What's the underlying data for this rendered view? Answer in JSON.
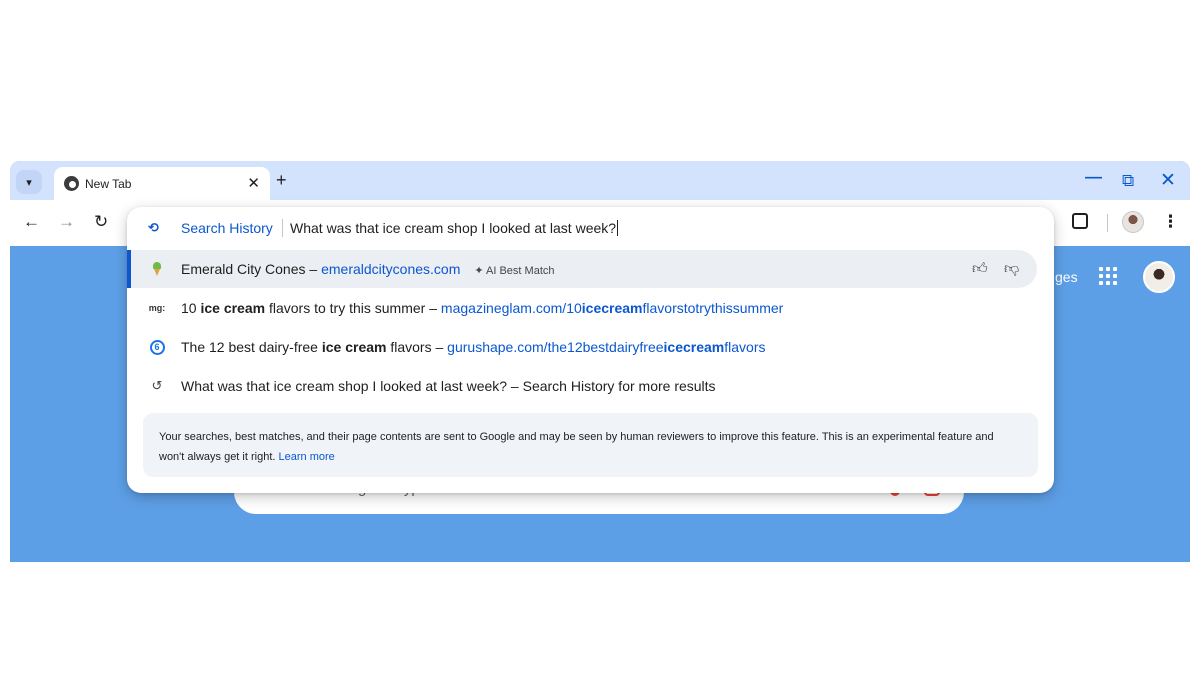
{
  "tab": {
    "title": "New Tab",
    "close_glyph": "✕",
    "new_tab_glyph": "+",
    "favicon": "chrome-icon"
  },
  "window_controls": {
    "minimize": "—",
    "restore": "⧉",
    "close": "✕"
  },
  "toolbar": {
    "back": "←",
    "forward": "→",
    "reload": "↻",
    "menu": "⋮"
  },
  "omnibox": {
    "scope_label": "Search History",
    "query": "What was that ice cream shop I looked at last week?",
    "suggestions": [
      {
        "icon": "ice-cream-cone-icon",
        "title": "Emerald City Cones",
        "separator": " – ",
        "url": "emeraldcitycones.com",
        "badge": "✦ AI Best Match",
        "selected": true
      },
      {
        "icon_text": "mg:",
        "title_pre": "10 ",
        "title_bold": "ice cream",
        "title_post": " flavors to try this summer",
        "separator": " – ",
        "url_pre": "magazineglam.com/10",
        "url_bold": "icecream",
        "url_post": "flavorstotrythissummer"
      },
      {
        "icon": "gurushape-icon",
        "title_pre": "The 12 best dairy-free ",
        "title_bold": "ice cream",
        "title_post": " flavors",
        "separator": " – ",
        "url_pre": "gurushape.com/the12bestdairyfree",
        "url_bold": "icecream",
        "url_post": "flavors"
      },
      {
        "icon": "history-icon",
        "text": "What was that ice cream shop I looked at last week? – Search History for more results"
      }
    ],
    "disclaimer": "Your searches, best matches, and their page contents are sent to Google and may be seen by human reviewers to improve this feature. This is an experimental feature and won't always get it right.",
    "learn_more": "Learn more"
  },
  "ntp": {
    "partial_link": "ges",
    "search_placeholder": "Search Google or type a URL"
  },
  "colors": {
    "accent": "#0b57d0",
    "ntp_background": "#5d9fe6",
    "tabstrip": "#d3e3fd"
  }
}
